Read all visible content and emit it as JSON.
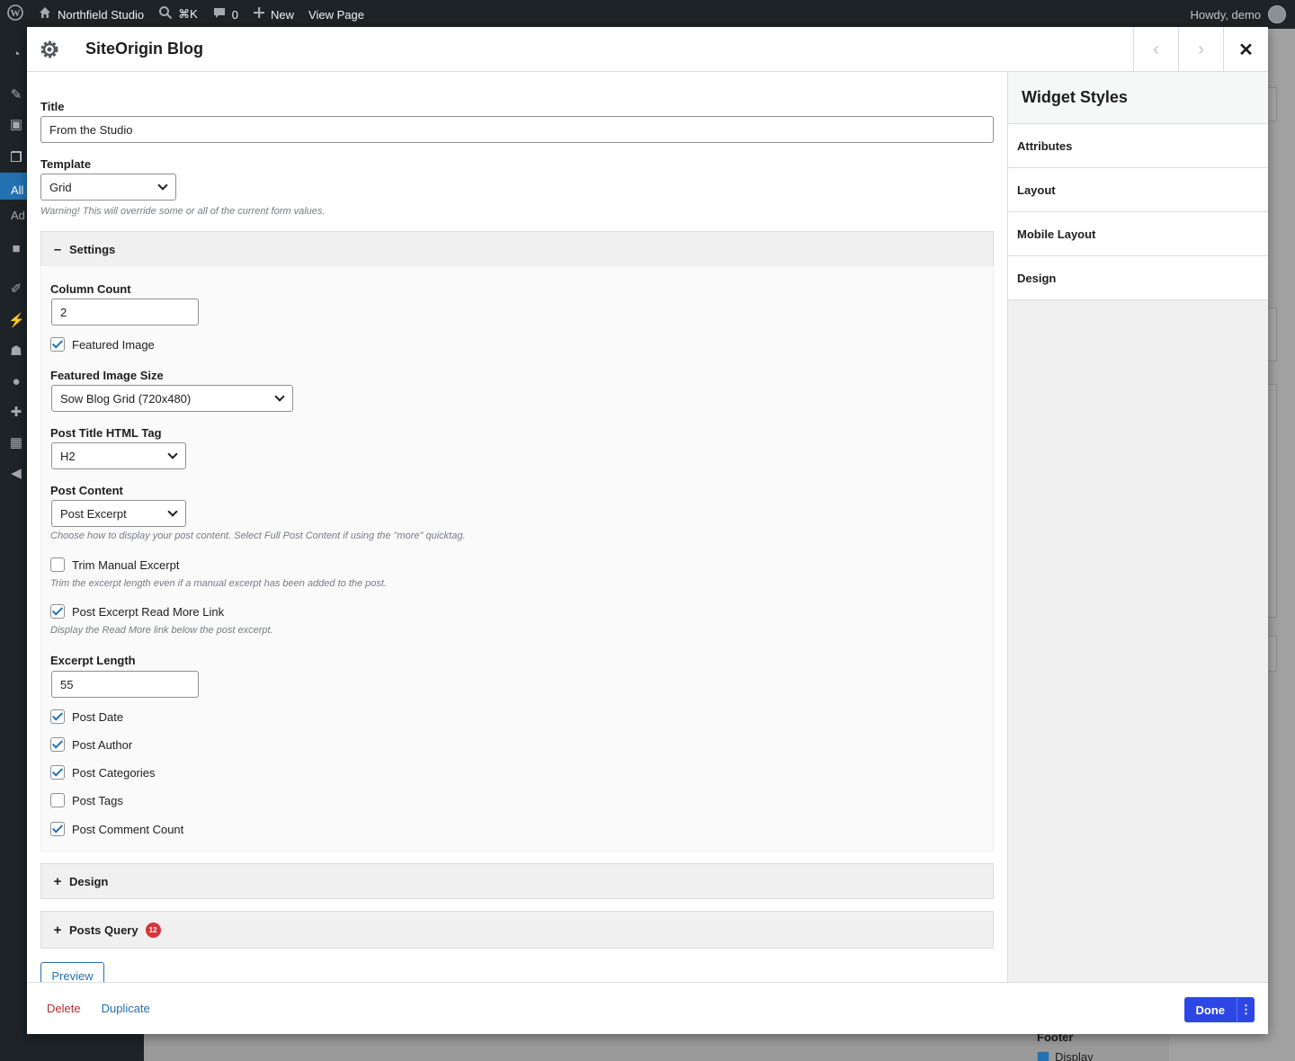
{
  "adminbar": {
    "site_name": "Northfield Studio",
    "shortcut": "⌘K",
    "comments_count": "0",
    "new_label": "New",
    "view_page": "View Page",
    "howdy": "Howdy, demo"
  },
  "sidemenu": {
    "sub_all": "All",
    "sub_add": "Ad"
  },
  "backdrop": {
    "footer_label": "Footer",
    "display_label": "Display"
  },
  "dialog": {
    "title": "SiteOrigin Blog",
    "nav_prev": "‹",
    "nav_next": "›",
    "close": "✕"
  },
  "form": {
    "title_label": "Title",
    "title_value": "From the Studio",
    "template_label": "Template",
    "template_value": "Grid",
    "template_warning": "Warning! This will override some or all of the current form values.",
    "settings_section": "Settings",
    "column_count_label": "Column Count",
    "column_count_value": "2",
    "featured_image_label": "Featured Image",
    "featured_image_checked": true,
    "featured_image_size_label": "Featured Image Size",
    "featured_image_size_value": "Sow Blog Grid (720x480)",
    "post_title_tag_label": "Post Title HTML Tag",
    "post_title_tag_value": "H2",
    "post_content_label": "Post Content",
    "post_content_value": "Post Excerpt",
    "post_content_note": "Choose how to display your post content. Select Full Post Content if using the \"more\" quicktag.",
    "trim_manual_label": "Trim Manual Excerpt",
    "trim_manual_note": "Trim the excerpt length even if a manual excerpt has been added to the post.",
    "read_more_label": "Post Excerpt Read More Link",
    "read_more_note": "Display the Read More link below the post excerpt.",
    "excerpt_length_label": "Excerpt Length",
    "excerpt_length_value": "55",
    "post_date_label": "Post Date",
    "post_author_label": "Post Author",
    "post_categories_label": "Post Categories",
    "post_tags_label": "Post Tags",
    "post_comment_count_label": "Post Comment Count",
    "design_section": "Design",
    "posts_query_section": "Posts Query",
    "posts_query_badge": "12",
    "preview_button": "Preview"
  },
  "sidebar": {
    "heading": "Widget Styles",
    "items": [
      {
        "label": "Attributes"
      },
      {
        "label": "Layout"
      },
      {
        "label": "Mobile Layout"
      },
      {
        "label": "Design"
      }
    ]
  },
  "footer": {
    "delete": "Delete",
    "duplicate": "Duplicate",
    "done": "Done",
    "more": "⋮"
  },
  "colors": {
    "accent": "#2271b1",
    "done_button": "#2c47e6",
    "delete": "#b32d2e",
    "badge": "#d63638"
  },
  "icons": {
    "wordpress": "wordpress-logo-icon",
    "home": "home-icon",
    "search": "search-icon",
    "comment": "comment-icon",
    "plus": "plus-icon",
    "gear": "gear-icon"
  }
}
